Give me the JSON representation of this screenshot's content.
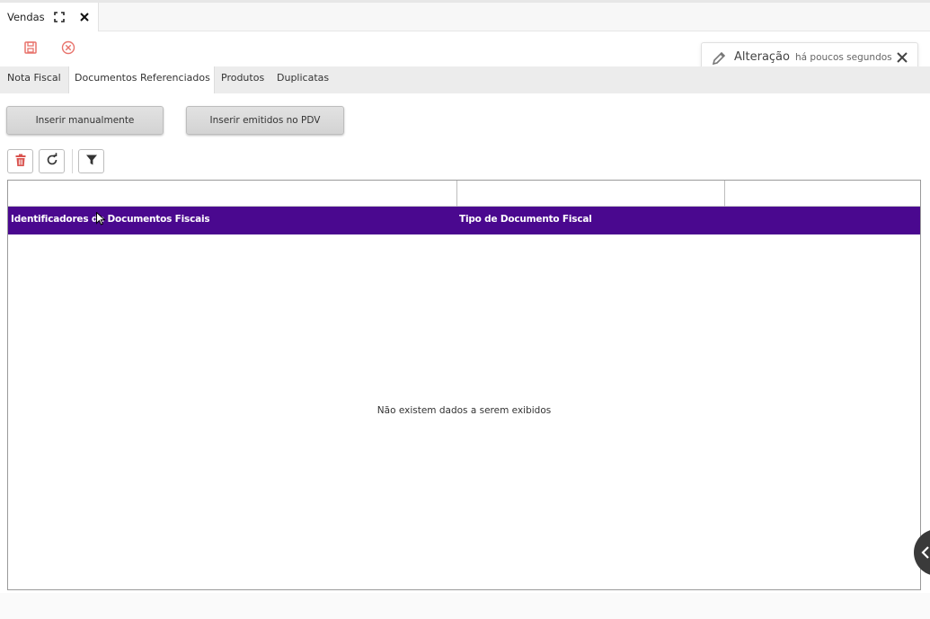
{
  "window": {
    "tab_title": "Vendas"
  },
  "toolbar": {
    "save_icon": "save-icon",
    "cancel_icon": "cancel-icon"
  },
  "notification": {
    "title": "Alteração",
    "time": "há poucos segundos"
  },
  "tabs": [
    {
      "label": "Nota Fiscal",
      "active": false
    },
    {
      "label": "Documentos Referenciados",
      "active": true
    },
    {
      "label": "Produtos",
      "active": false
    },
    {
      "label": "Duplicatas",
      "active": false
    }
  ],
  "actions": {
    "insert_manual": "Inserir manualmente",
    "insert_pdv": "Inserir emitidos no PDV"
  },
  "grid": {
    "columns": [
      "Identificadores de Documentos Fiscais",
      "Tipo de Documento Fiscal"
    ],
    "empty_message": "Não existem dados a serem exibidos"
  },
  "colors": {
    "header_bg": "#4a088f",
    "delete_red": "#d9534f",
    "cancel_red": "#e8736c"
  }
}
